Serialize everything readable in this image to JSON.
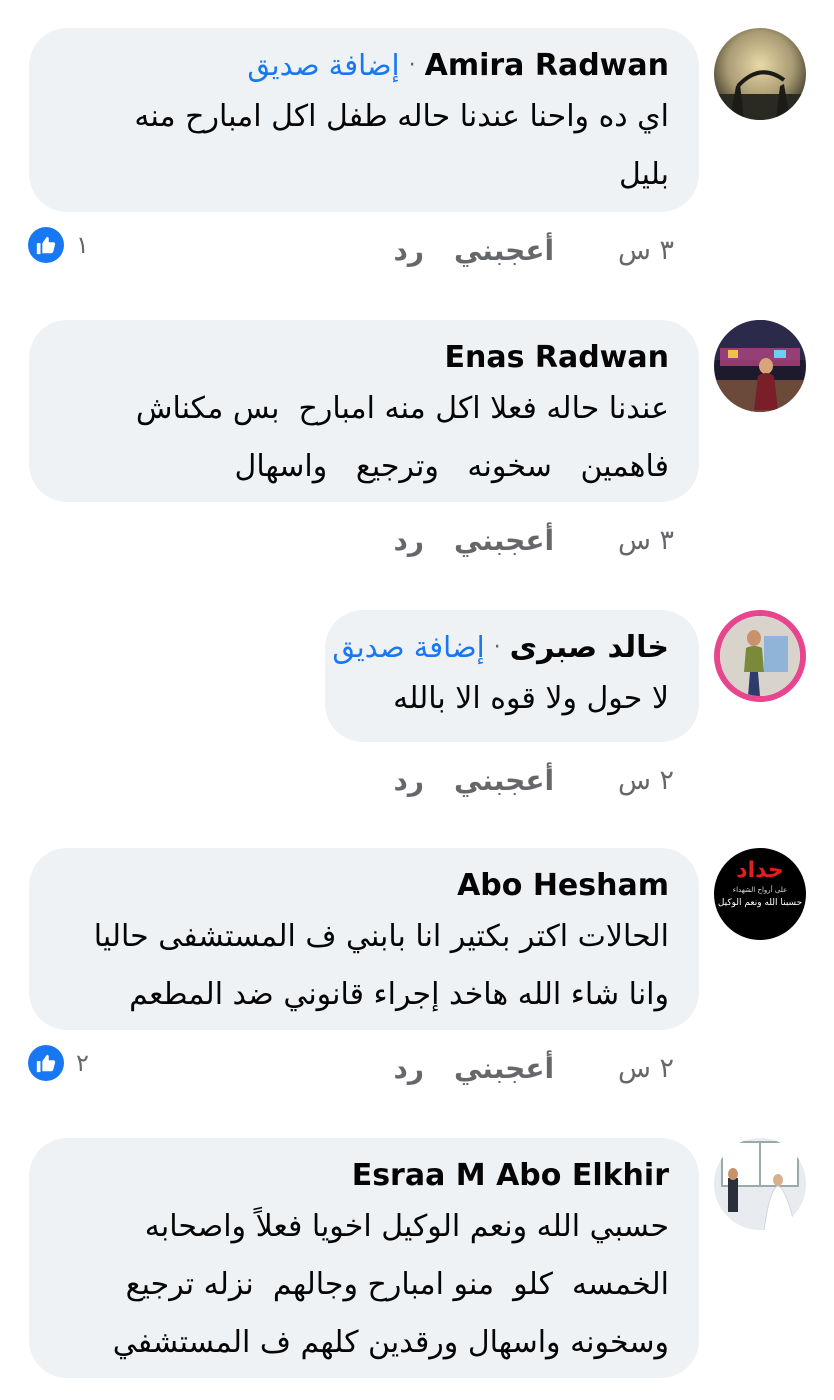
{
  "comments": [
    {
      "name": "Amira Radwan",
      "add_friend": "إضافة صديق",
      "separator": "·",
      "lines": [
        "اي ده واحنا عندنا حاله طفل اكل امبارح منه",
        "بليل"
      ],
      "time": "٣ س",
      "like": "أعجبني",
      "reply": "رد",
      "reaction_count": "١"
    },
    {
      "name": "Enas Radwan",
      "lines": [
        "عندنا حاله فعلا اكل منه امبارح  بس مكناش",
        "فاهمين   سخونه   وترجيع   واسهال"
      ],
      "time": "٣ س",
      "like": "أعجبني",
      "reply": "رد"
    },
    {
      "name": "خالد صبرى",
      "add_friend": "إضافة صديق",
      "separator": "·",
      "lines": [
        "لا حول ولا قوه الا بالله"
      ],
      "time": "٢ س",
      "like": "أعجبني",
      "reply": "رد"
    },
    {
      "name": "Abo Hesham",
      "avatar_text_top": "حداد",
      "avatar_text_mid": "على أرواح الشهداء",
      "avatar_text_bottom": "حسبنا الله ونعم الوكيل",
      "lines": [
        "الحالات اكتر بكتير انا بابني ف المستشفى حاليا",
        "وانا شاء الله هاخد إجراء قانوني ضد المطعم"
      ],
      "time": "٢ س",
      "like": "أعجبني",
      "reply": "رد",
      "reaction_count": "٢"
    },
    {
      "name": "Esraa M Abo Elkhir",
      "lines": [
        "حسبي الله ونعم الوكيل اخويا فعلاً واصحابه",
        "الخمسه  كلو  منو امبارح وجالهم  نزله ترجيع",
        "وسخونه واسهال ورقدين كلهم ف المستشفي"
      ]
    }
  ],
  "colors": {
    "bubble": "#eff2f5",
    "link": "#1877f2",
    "meta": "#65676b",
    "text": "#050505"
  }
}
